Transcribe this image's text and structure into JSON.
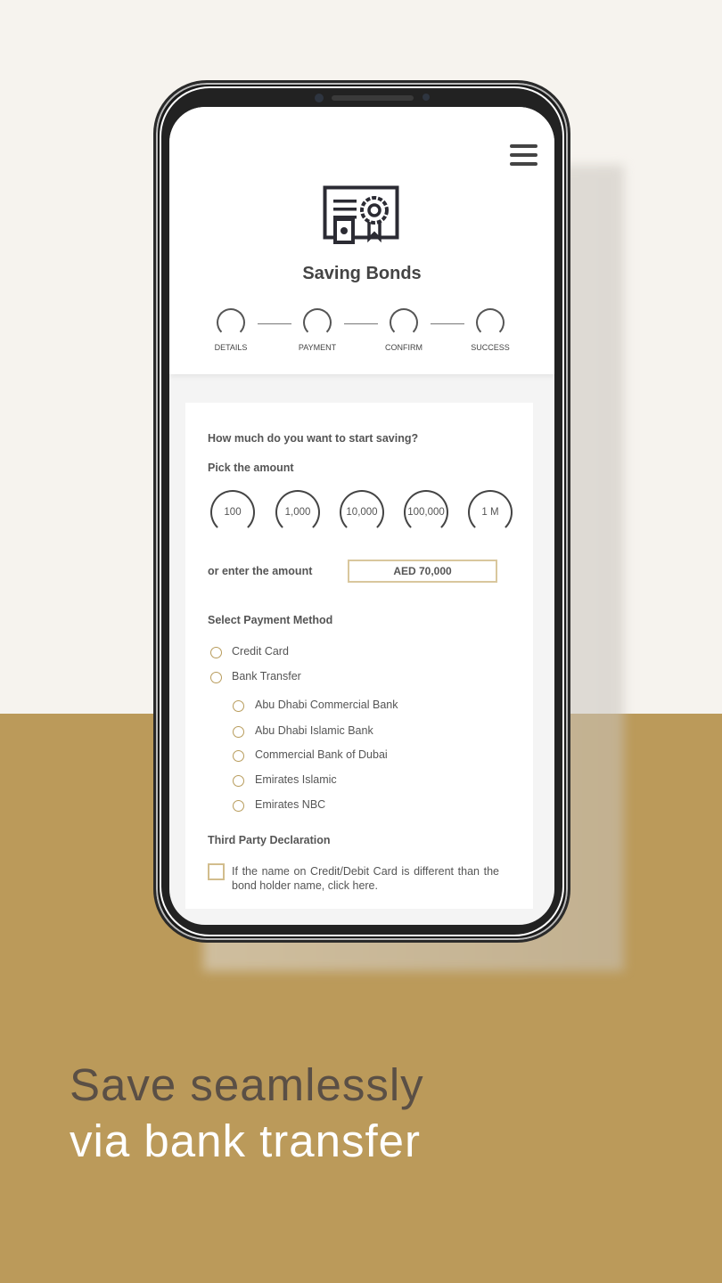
{
  "header": {
    "title": "Saving Bonds",
    "icon": "certificate-icon",
    "menu_icon": "hamburger-icon"
  },
  "steps": [
    "DETAILS",
    "PAYMENT",
    "CONFIRM",
    "SUCCESS"
  ],
  "form": {
    "question": "How much do you want to start saving?",
    "pick_label": "Pick the amount",
    "amounts": [
      "100",
      "1,000",
      "10,000",
      "100,000",
      "1 M"
    ],
    "enter_label": "or enter the amount",
    "amount_value": "AED 70,000",
    "payment_label": "Select Payment Method",
    "methods": [
      "Credit Card",
      "Bank Transfer"
    ],
    "banks": [
      "Abu Dhabi Commercial Bank",
      "Abu Dhabi Islamic Bank",
      "Commercial Bank of Dubai",
      "Emirates Islamic",
      "Emirates NBC"
    ],
    "third_party_label": "Third Party Declaration",
    "third_party_text": "If the name on Credit/Debit Card is different than the bond holder name, click here."
  },
  "slogan": {
    "line1": "Save seamlessly",
    "line2": "via bank transfer"
  },
  "colors": {
    "gold": "#bb9a5a",
    "cream": "#f6f3ee",
    "text": "#555555"
  }
}
